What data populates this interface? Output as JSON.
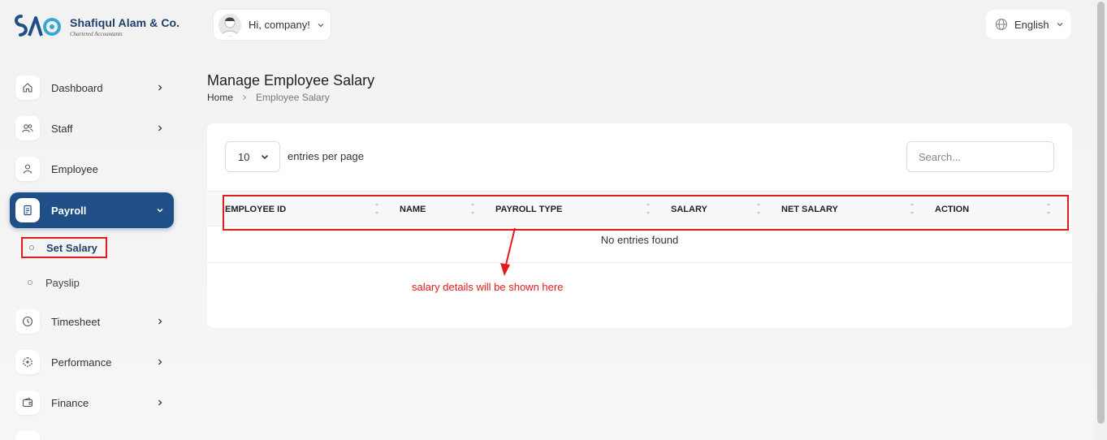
{
  "brand": {
    "name": "Shafiqul Alam & Co.",
    "subtitle": "Chartered Accountants"
  },
  "header": {
    "greeting": "Hi, company!",
    "language": "English"
  },
  "sidebar": {
    "items": [
      {
        "label": "Dashboard",
        "icon": "home-icon",
        "has_arrow": true
      },
      {
        "label": "Staff",
        "icon": "users-icon",
        "has_arrow": true
      },
      {
        "label": "Employee",
        "icon": "user-icon",
        "has_arrow": false
      },
      {
        "label": "Payroll",
        "icon": "document-icon",
        "has_arrow": true,
        "active": true
      },
      {
        "label": "Timesheet",
        "icon": "clock-icon",
        "has_arrow": true
      },
      {
        "label": "Performance",
        "icon": "performance-icon",
        "has_arrow": true
      },
      {
        "label": "Finance",
        "icon": "wallet-icon",
        "has_arrow": true
      }
    ],
    "payroll_sub": [
      {
        "label": "Set Salary",
        "active": true
      },
      {
        "label": "Payslip",
        "active": false
      }
    ]
  },
  "page": {
    "title": "Manage Employee Salary",
    "breadcrumb": {
      "home": "Home",
      "current": "Employee Salary"
    }
  },
  "table": {
    "per_page_value": "10",
    "per_page_label": "entries per page",
    "search_placeholder": "Search...",
    "columns": [
      "EMPLOYEE ID",
      "NAME",
      "PAYROLL TYPE",
      "SALARY",
      "NET SALARY",
      "ACTION"
    ],
    "empty_message": "No entries found"
  },
  "annotation": {
    "text": "salary details will be shown here",
    "color": "#e21b1b"
  },
  "colors": {
    "accent": "#1f4f86",
    "highlight": "#e21b1b"
  }
}
